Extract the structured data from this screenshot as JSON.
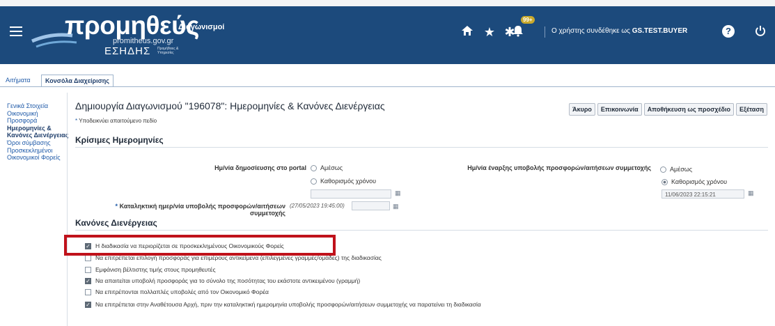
{
  "header": {
    "logo_main": "προμηθεύς",
    "logo_url": "promitheus.gov.gr",
    "logo_esidis": "ΕΣΗΔΗΣ",
    "logo_sub": "Προμήθειες & Υπηρεσίες",
    "app_name": "Διαγωνισμοί",
    "notification_count": "99+",
    "user_prefix": "Ο χρήστης συνδέθηκε ως",
    "user_name": "GS.TEST.BUYER",
    "help_glyph": "?",
    "icons": [
      "menu-icon",
      "home-icon",
      "star-icon",
      "settings-icon",
      "bell-icon",
      "help-icon",
      "power-icon"
    ]
  },
  "tabs": [
    {
      "label": "Αιτήματα",
      "active": false
    },
    {
      "label": "Κονσόλα Διαχείρισης",
      "active": true
    }
  ],
  "sidenav": [
    {
      "label": "Γενικά Στοιχεία",
      "active": false
    },
    {
      "label": "Οικονομική Προσφορά",
      "active": false
    },
    {
      "label": "Ημερομηνίες & Κανόνες Διενέργειας",
      "active": true
    },
    {
      "label": "Όροι σύμβασης",
      "active": false
    },
    {
      "label": "Προσκεκλημένοι Οικονομικοί Φορείς",
      "active": false
    }
  ],
  "page": {
    "title": "Δημιουργία Διαγωνισμού \"196078\": Ημερομηνίες & Κανόνες Διενέργειας",
    "required_star": "*",
    "required_note": "Υποδεικνύει απαιτούμενο πεδίο",
    "buttons": {
      "cancel": "Άκυρο",
      "communication": "Επικοινωνία",
      "save_draft": "Αποθήκευση ως προσχέδιο",
      "review": "Εξέταση"
    }
  },
  "critical_dates": {
    "section_title": "Κρίσιμες Ημερομηνίες",
    "publish_label": "Ημ/νία δημοσίευσης στο portal",
    "publish_option_now": "Αμέσως",
    "publish_option_scheduled": "Καθορισμός χρόνου",
    "publish_selected": "none",
    "publish_value": "",
    "start_label": "Ημ/νία έναρξης υποβολής προσφορών/αιτήσεων συμμετοχής",
    "start_option_now": "Αμέσως",
    "start_option_scheduled": "Καθορισμός χρόνου",
    "start_selected": "scheduled",
    "start_value": "11/06/2023 22:15:21",
    "deadline_label": "Καταληκτική ημερ/νία υποβολής προσφορών/αιτήσεων συμμετοχής",
    "deadline_placeholder": "(27/05/2023 19:45:00)",
    "deadline_value": ""
  },
  "rules": {
    "section_title": "Κανόνες Διενέργειας",
    "items": [
      {
        "label": "Η διαδικασία να περιορίζεται σε προσκεκλημένους Οικονομικούς Φορείς",
        "checked": true,
        "highlighted": true
      },
      {
        "label": "Να επιτρέπεται επιλογή προσφοράς για επιμέρους αντικείμενα (επιλεγμένες γραμμές/ομάδες) της διαδικασίας",
        "checked": false,
        "highlighted": false
      },
      {
        "label": "Εμφάνιση βέλτιστης τιμής στους προμηθευτές",
        "checked": false,
        "highlighted": false
      },
      {
        "label": "Να απαιτείται υποβολή προσφοράς για το σύνολο της ποσότητας του εκάστοτε αντικειμένου (γραμμή)",
        "checked": true,
        "highlighted": false
      },
      {
        "label": "Να επιτρέπονται πολλαπλές υποβολές από τον Οικονομικό Φορέα",
        "checked": false,
        "highlighted": false
      },
      {
        "label": "Να επιτρέπεται στην Αναθέτουσα Αρχή, πριν την καταληκτική ημερομηνία υποβολής προσφορών/αιτήσεων συμμετοχής να παρατείνει τη διαδικασία",
        "checked": true,
        "highlighted": false
      }
    ]
  },
  "colors": {
    "header_bg": "#1c4a7c",
    "link": "#1f5aa8",
    "highlight_border": "#c0121b"
  }
}
